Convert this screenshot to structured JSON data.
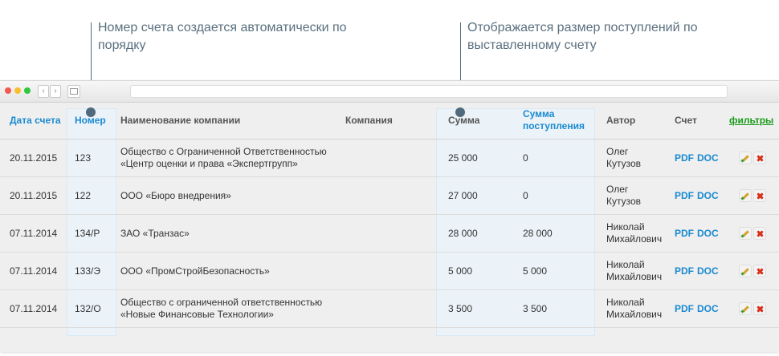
{
  "callouts": {
    "number_note": "Номер счета создается автоматически по порядку",
    "sum_note": "Отображается размер поступлений по выставленному счету"
  },
  "browser": {
    "traffic_lights": [
      "#f25a51",
      "#f7be2e",
      "#2fc840"
    ],
    "back_icon": "chevron-left-icon",
    "forward_icon": "chevron-right-icon",
    "sidebar_icon": "sidebar-icon"
  },
  "table": {
    "headers": {
      "date": "Дата счета",
      "number": "Номер",
      "company_name": "Наименование компании",
      "company": "Компания",
      "sum": "Сумма",
      "received": "Сумма поступления",
      "author": "Автор",
      "invoice": "Счет",
      "filters": "фильтры"
    },
    "rows": [
      {
        "date": "20.11.2015",
        "number": "123",
        "company_name": "Общество с Ограниченной Ответственностью «Центр оценки и права «Экспертгрупп»",
        "company": "",
        "sum": "25 000",
        "received": "0",
        "author": "Олег Кутузов",
        "pdf": "PDF",
        "doc": "DOC"
      },
      {
        "date": "20.11.2015",
        "number": "122",
        "company_name": "ООО «Бюро внедрения»",
        "company": "",
        "sum": "27 000",
        "received": "0",
        "author": "Олег Кутузов",
        "pdf": "PDF",
        "doc": "DOC"
      },
      {
        "date": "07.11.2014",
        "number": "134/Р",
        "company_name": "ЗАО «Транзас»",
        "company": "",
        "sum": "28 000",
        "received": "28 000",
        "author": "Николай Михайлович",
        "pdf": "PDF",
        "doc": "DOC"
      },
      {
        "date": "07.11.2014",
        "number": "133/Э",
        "company_name": "ООО «ПромСтройБезопасность»",
        "company": "",
        "sum": "5 000",
        "received": "5 000",
        "author": "Николай Михайлович",
        "pdf": "PDF",
        "doc": "DOC"
      },
      {
        "date": "07.11.2014",
        "number": "132/О",
        "company_name": "Общество с ограниченной ответственностью «Новые Финансовые Технологии»",
        "company": "",
        "sum": "3 500",
        "received": "3 500",
        "author": "Николай Михайлович",
        "pdf": "PDF",
        "doc": "DOC"
      }
    ],
    "actions": {
      "edit_icon": "pencil-icon",
      "delete_icon": "close-icon"
    }
  }
}
